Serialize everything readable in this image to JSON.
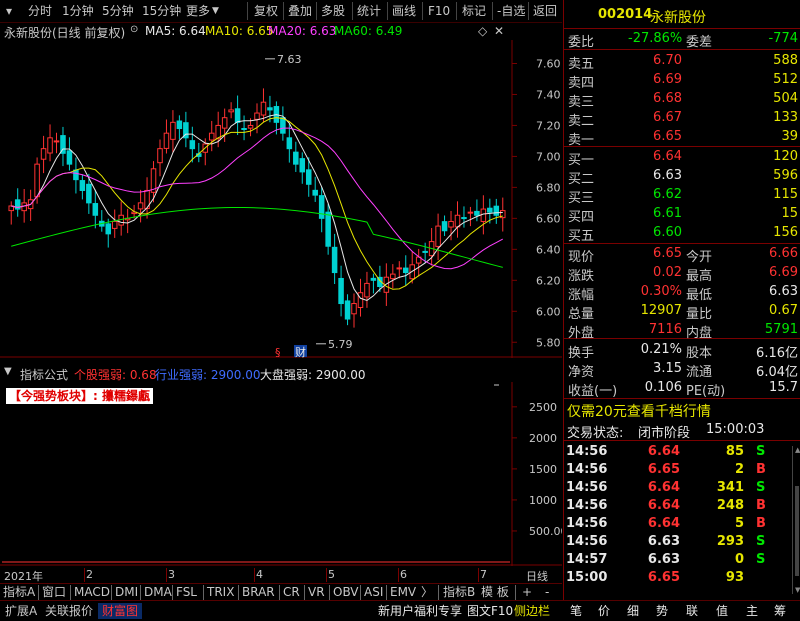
{
  "toolbar": {
    "items": [
      "分时",
      "1分钟",
      "5分钟",
      "15分钟",
      "更多",
      "复权",
      "叠加",
      "多股",
      "统计",
      "画线",
      "F10",
      "标记",
      "-自选",
      "返回"
    ]
  },
  "chart_header": {
    "stock": "永新股份(日线 前复权)",
    "ma5": "MA5: 6.64",
    "ma10": "MA10: 6.65",
    "ma20": "MA20: 6.63",
    "ma60": "MA60: 6.49"
  },
  "price_axis": [
    "7.60",
    "7.40",
    "7.20",
    "7.00",
    "6.80",
    "6.60",
    "6.40",
    "6.20",
    "6.00",
    "5.80"
  ],
  "price_marks": {
    "high": "7.63",
    "low": "5.79"
  },
  "chart_markers": [
    "§",
    "财"
  ],
  "indicator_header": {
    "formula": "指标公式",
    "stock_strength": "个股强弱: 0.68",
    "industry_strength": "行业强弱: 2900.00",
    "market_strength": "大盘强弱: 2900.00",
    "sector_tag": "【今强势板块】: 攥糯鑤甗"
  },
  "indicator_axis": [
    "2500",
    "2000",
    "1500",
    "1000",
    "500.00"
  ],
  "date_axis": [
    "2021年",
    "2",
    "3",
    "4",
    "5",
    "6",
    "7"
  ],
  "date_axis_right": "日线",
  "bottom_tabs": [
    "指标A",
    "窗口",
    "MACD",
    "DMI",
    "DMA",
    "FSL",
    "TRIX",
    "BRAR",
    "CR",
    "VR",
    "OBV",
    "ASI",
    "EMV",
    "指标B",
    "模 板",
    "+",
    "-"
  ],
  "footer": {
    "left": [
      "扩展A",
      "关联报价",
      "财富图"
    ],
    "middle": [
      "新用户福利专享",
      "图文F10",
      "侧边栏"
    ],
    "right": [
      "笔",
      "价",
      "细",
      "势",
      "联",
      "值",
      "主",
      "筹"
    ]
  },
  "quote": {
    "code": "002014",
    "name": "永新股份",
    "webi_label": "委比",
    "webi": "-27.86%",
    "wecha_label": "委差",
    "wecha": "-774",
    "asks": [
      {
        "label": "卖五",
        "price": "6.70",
        "vol": "588"
      },
      {
        "label": "卖四",
        "price": "6.69",
        "vol": "512"
      },
      {
        "label": "卖三",
        "price": "6.68",
        "vol": "504"
      },
      {
        "label": "卖二",
        "price": "6.67",
        "vol": "133"
      },
      {
        "label": "卖一",
        "price": "6.65",
        "vol": "39"
      }
    ],
    "bids": [
      {
        "label": "买一",
        "price": "6.64",
        "vol": "120"
      },
      {
        "label": "买二",
        "price": "6.63",
        "vol": "596"
      },
      {
        "label": "买三",
        "price": "6.62",
        "vol": "115"
      },
      {
        "label": "买四",
        "price": "6.61",
        "vol": "15"
      },
      {
        "label": "买五",
        "price": "6.60",
        "vol": "156"
      }
    ],
    "stats": [
      {
        "l1": "现价",
        "v1": "6.65",
        "l2": "今开",
        "v2": "6.66"
      },
      {
        "l1": "涨跌",
        "v1": "0.02",
        "l2": "最高",
        "v2": "6.69"
      },
      {
        "l1": "涨幅",
        "v1": "0.30%",
        "l2": "最低",
        "v2": "6.63"
      },
      {
        "l1": "总量",
        "v1": "12907",
        "l2": "量比",
        "v2": "0.67"
      },
      {
        "l1": "外盘",
        "v1": "7116",
        "l2": "内盘",
        "v2": "5791"
      }
    ],
    "stats2": [
      {
        "l1": "换手",
        "v1": "0.21%",
        "l2": "股本",
        "v2": "6.16亿"
      },
      {
        "l1": "净资",
        "v1": "3.15",
        "l2": "流通",
        "v2": "6.04亿"
      },
      {
        "l1": "收益(一)",
        "v1": "0.106",
        "l2": "PE(动)",
        "v2": "15.7"
      }
    ],
    "promo": "仅需20元查看千档行情",
    "status_label": "交易状态:",
    "status_value": "闭市阶段",
    "status_time": "15:00:03",
    "ticks": [
      {
        "t": "14:56",
        "p": "6.64",
        "v": "85",
        "bs": "S"
      },
      {
        "t": "14:56",
        "p": "6.65",
        "v": "2",
        "bs": "B"
      },
      {
        "t": "14:56",
        "p": "6.64",
        "v": "341",
        "bs": "S"
      },
      {
        "t": "14:56",
        "p": "6.64",
        "v": "248",
        "bs": "B"
      },
      {
        "t": "14:56",
        "p": "6.64",
        "v": "5",
        "bs": "B"
      },
      {
        "t": "14:56",
        "p": "6.63",
        "v": "293",
        "bs": "S"
      },
      {
        "t": "14:57",
        "p": "6.63",
        "v": "0",
        "bs": "S"
      },
      {
        "t": "15:00",
        "p": "6.65",
        "v": "93",
        "bs": ""
      }
    ]
  },
  "colors": {
    "up": "#ff3232",
    "down": "#00e600",
    "ma5": "#e8e8e8",
    "ma10": "#e6e600",
    "ma20": "#ff40ff",
    "ma60": "#00e600",
    "grid": "#7a0000"
  }
}
